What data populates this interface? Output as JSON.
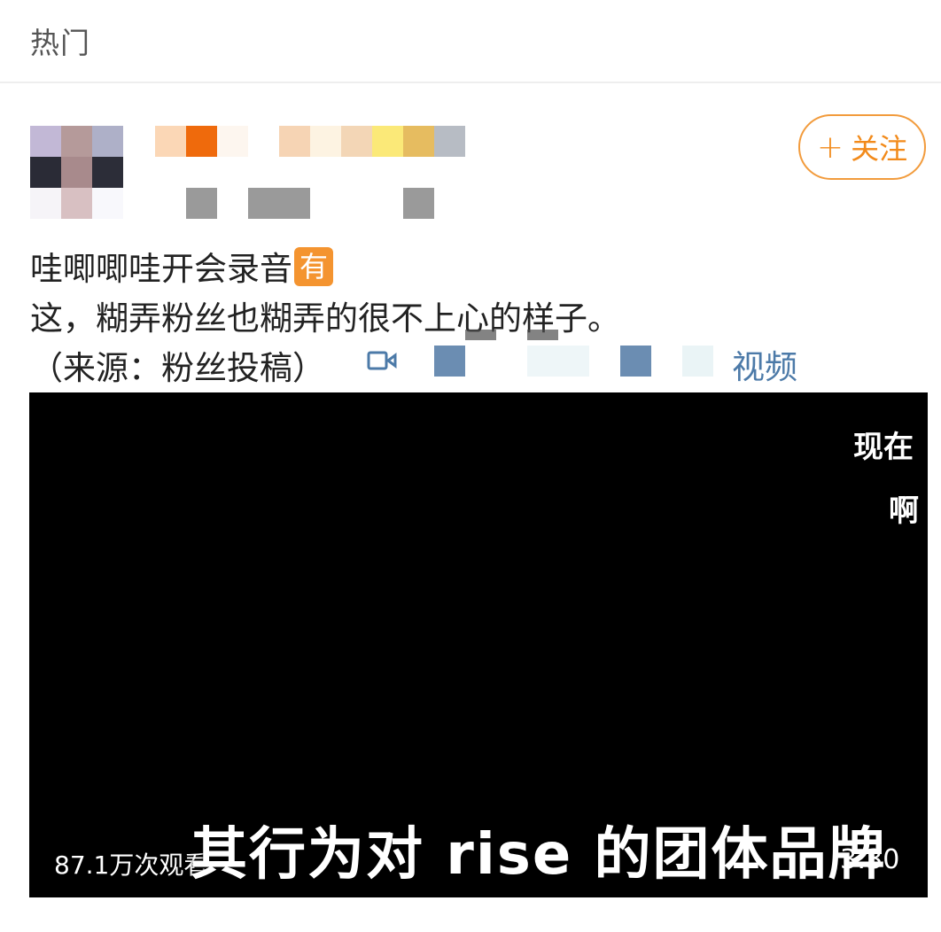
{
  "header": {
    "title": "热门"
  },
  "post": {
    "follow_label": "关注",
    "follow_plus": "+",
    "lines": [
      "哇唧唧哇开会录音",
      "这，糊弄粉丝也糊弄的很不上心的样子。",
      "（来源：粉丝投稿）"
    ],
    "badge": "有",
    "video_link_label": "视频"
  },
  "video": {
    "subtitle": "其行为对 rise 的团体品牌",
    "right_text_1": "现在",
    "right_text_2": "啊",
    "views": "87.1万次观看",
    "duration": "3:30"
  },
  "colors": {
    "accent": "#f28a1a",
    "link": "#4c7aa8",
    "badge": "#f49430"
  },
  "icons": {
    "video_link": "video-camera-icon"
  }
}
